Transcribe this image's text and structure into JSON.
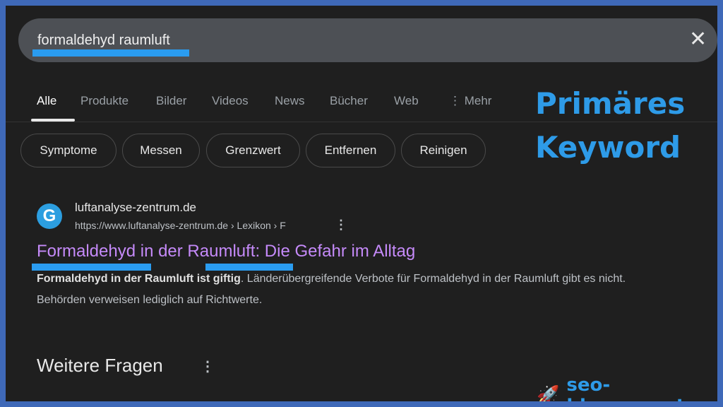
{
  "search": {
    "query": "formaldehyd raumluft",
    "clear_icon": "close-icon"
  },
  "tabs": [
    {
      "label": "Alle",
      "active": true
    },
    {
      "label": "Produkte"
    },
    {
      "label": "Bilder"
    },
    {
      "label": "Videos"
    },
    {
      "label": "News"
    },
    {
      "label": "Bücher"
    },
    {
      "label": "Web"
    },
    {
      "label": "⋮ Mehr"
    }
  ],
  "chips": [
    "Symptome",
    "Messen",
    "Grenzwert",
    "Entfernen",
    "Reinigen"
  ],
  "annotation": {
    "line1": "Primäres",
    "line2": "Keyword",
    "color": "#2e9be8"
  },
  "result": {
    "site": "luftanalyse-zentrum.de",
    "breadcrumb": "https://www.luftanalyse-zentrum.de › Lexikon › F",
    "title": "Formaldehyd in der Raumluft: Die Gefahr im Alltag",
    "snippet_bold": "Formaldehyd in der Raumluft ist giftig",
    "snippet_rest": ". Länderübergreifende Verbote für Formaldehyd in der Raumluft gibt es nicht. Behörden verweisen lediglich auf Richtwerte."
  },
  "section": {
    "title": "Weitere Fragen"
  },
  "brand": {
    "name": "seo-blogger.net",
    "icon": "rocket-icon"
  },
  "colors": {
    "frame": "#3f69b8",
    "background": "#1f1f1f",
    "highlight": "#2a9cf0",
    "link": "#c58af9"
  }
}
